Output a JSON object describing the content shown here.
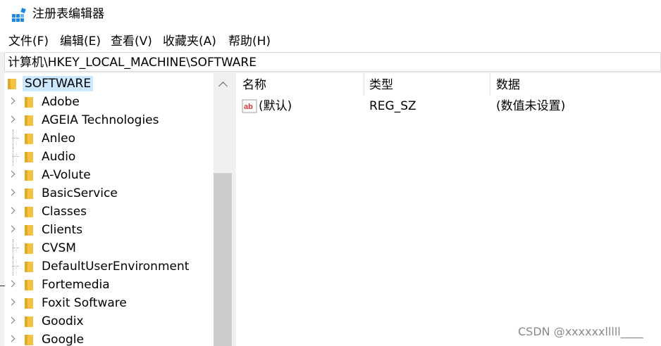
{
  "window": {
    "title": "注册表编辑器"
  },
  "menu": [
    "文件(F)",
    "编辑(E)",
    "查看(V)",
    "收藏夹(A)",
    "帮助(H)"
  ],
  "address": "计算机\\HKEY_LOCAL_MACHINE\\SOFTWARE",
  "tree": {
    "root": "SOFTWARE",
    "items": [
      {
        "label": "Adobe",
        "expandable": true
      },
      {
        "label": "AGEIA Technologies",
        "expandable": true
      },
      {
        "label": "Anleo",
        "expandable": false
      },
      {
        "label": "Audio",
        "expandable": false
      },
      {
        "label": "A-Volute",
        "expandable": true
      },
      {
        "label": "BasicService",
        "expandable": true
      },
      {
        "label": "Classes",
        "expandable": true
      },
      {
        "label": "Clients",
        "expandable": true
      },
      {
        "label": "CVSM",
        "expandable": false
      },
      {
        "label": "DefaultUserEnvironment",
        "expandable": false
      },
      {
        "label": "Fortemedia",
        "expandable": true
      },
      {
        "label": "Foxit Software",
        "expandable": true
      },
      {
        "label": "Goodix",
        "expandable": true
      },
      {
        "label": "Google",
        "expandable": true
      }
    ]
  },
  "values": {
    "headers": {
      "name": "名称",
      "type": "类型",
      "data": "数据"
    },
    "rows": [
      {
        "name": "(默认)",
        "type": "REG_SZ",
        "data": "(数值未设置)"
      }
    ]
  },
  "colors": {
    "folder": "#f5c342",
    "selection": "#cce8ff",
    "icon_accent": "#d13438"
  },
  "watermark": "CSDN @xxxxxxlllll____"
}
